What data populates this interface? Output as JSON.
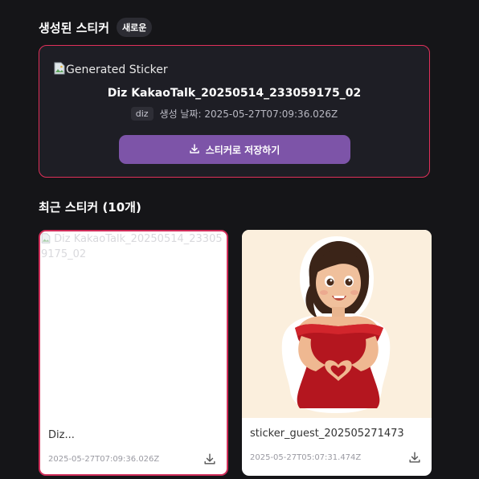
{
  "generated": {
    "heading": "생성된 스티커",
    "badge": "새로운",
    "image_alt": "Generated Sticker",
    "name": "Diz KakaoTalk_20250514_233059175_02",
    "tag": "diz",
    "created_label": "생성 날짜: 2025-05-27T07:09:36.026Z",
    "save_button_label": "스티커로 저장하기",
    "accent_color": "#7d54a8",
    "border_color": "#e0305a"
  },
  "recent": {
    "heading": "최근 스티커 (10개)",
    "cards": [
      {
        "image_alt": "Diz KakaoTalk_20250514_233059175_02",
        "title": "Diz...",
        "date": "2025-05-27T07:09:36.026Z",
        "selected": true
      },
      {
        "image_alt": "sticker_guest_202505271473",
        "title": "sticker_guest_202505271473",
        "date": "2025-05-27T05:07:31.474Z",
        "selected": false
      }
    ]
  },
  "icons": {
    "broken_image": "broken-image-icon",
    "download": "download-icon"
  }
}
